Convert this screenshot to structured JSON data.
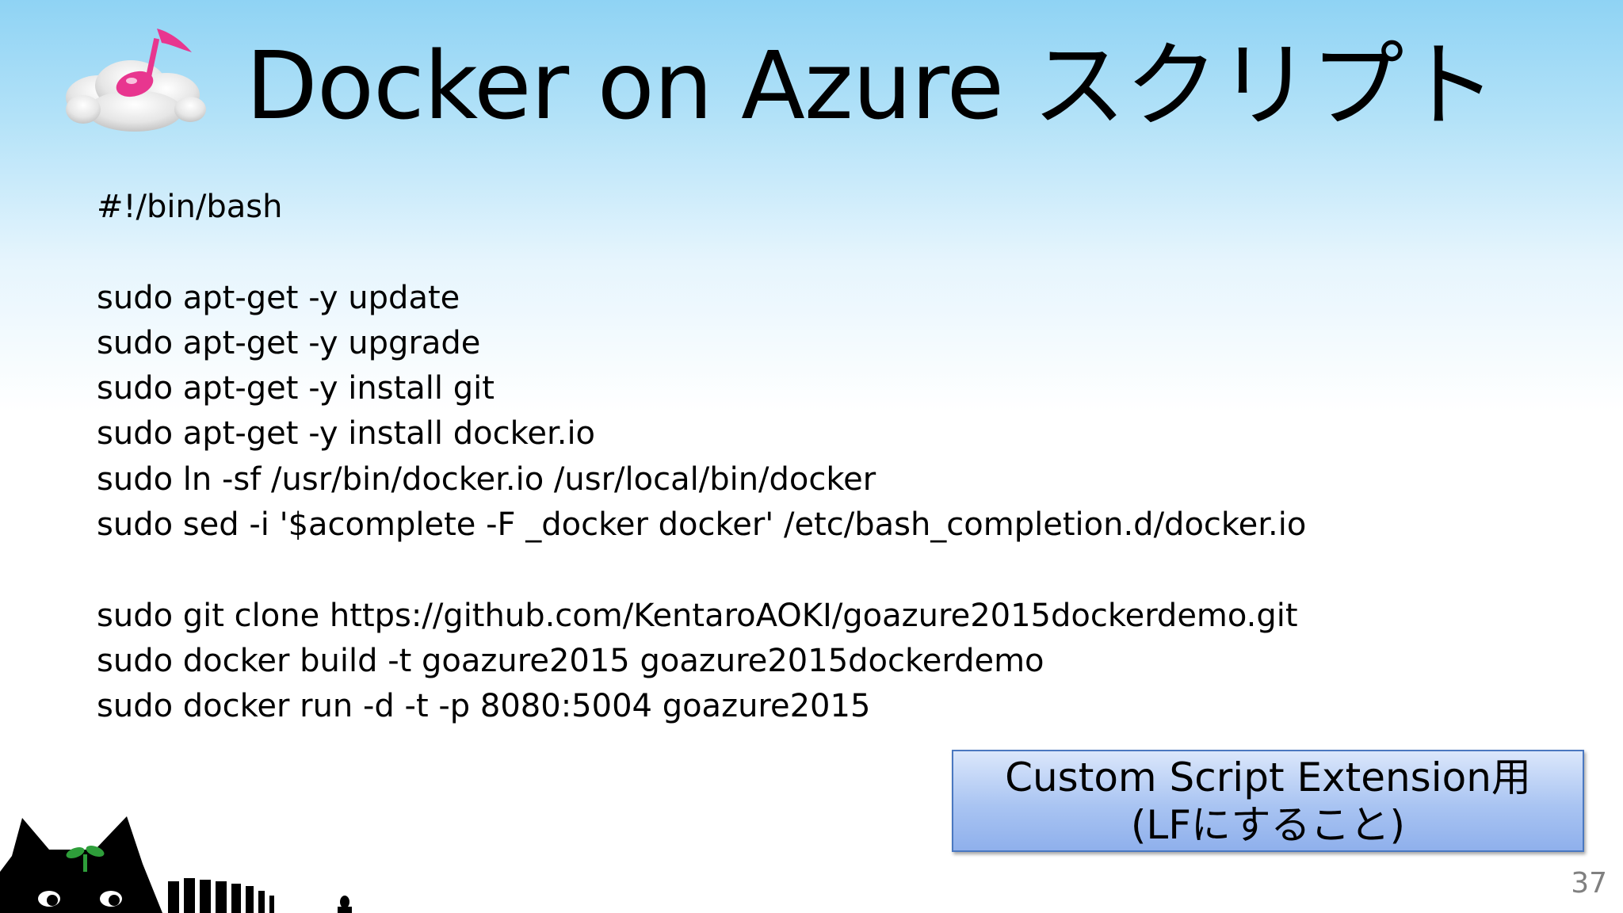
{
  "slide": {
    "title": "Docker on Azure スクリプト",
    "logo_icon": "cloud-music-note-icon",
    "mascot_icon": "black-cat-with-sprout-icon",
    "page_number": "37",
    "colors": {
      "background_top": "#8fd3f4",
      "background_bottom": "#ffffff",
      "callout_fill": "#a9c4f2",
      "callout_border": "#4a78c0",
      "music_note": "#e8368f"
    }
  },
  "script": {
    "lines": [
      "#!/bin/bash",
      "",
      "sudo apt-get -y update",
      "sudo apt-get -y upgrade",
      "sudo apt-get -y install git",
      "sudo apt-get -y install docker.io",
      "sudo ln -sf /usr/bin/docker.io /usr/local/bin/docker",
      "sudo sed -i '$acomplete -F _docker docker' /etc/bash_completion.d/docker.io",
      "",
      "sudo git clone https://github.com/KentaroAOKI/goazure2015dockerdemo.git",
      "sudo docker build -t goazure2015 goazure2015dockerdemo",
      "sudo docker run -d -t -p 8080:5004 goazure2015"
    ]
  },
  "callout": {
    "line1": "Custom Script Extension用",
    "line2": "(LFにすること)"
  }
}
